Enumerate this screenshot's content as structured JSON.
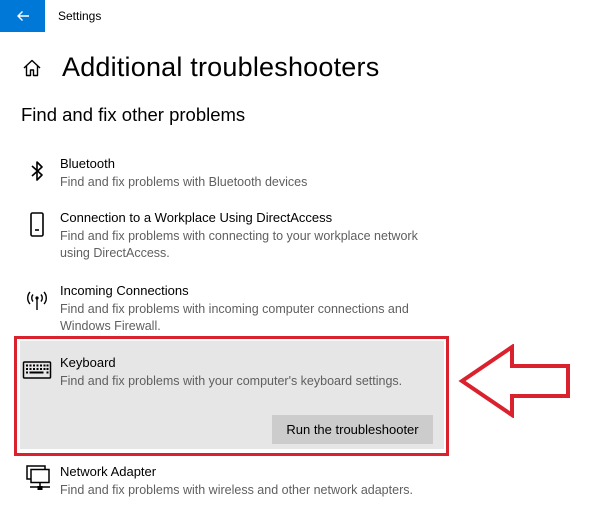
{
  "window": {
    "app_title": "Settings",
    "accent_color": "#0078d7",
    "back_icon": "back-arrow-icon"
  },
  "header": {
    "home_icon": "home-icon",
    "page_title": "Additional troubleshooters",
    "section_title": "Find and fix other problems"
  },
  "items": [
    {
      "icon": "bluetooth-icon",
      "label": "Bluetooth",
      "description": "Find and fix problems with Bluetooth devices"
    },
    {
      "icon": "phone-device-icon",
      "label": "Connection to a Workplace Using DirectAccess",
      "description": "Find and fix problems with connecting to your workplace network using DirectAccess."
    },
    {
      "icon": "wireless-signal-icon",
      "label": "Incoming Connections",
      "description": "Find and fix problems with incoming computer connections and Windows Firewall."
    },
    {
      "icon": "keyboard-icon",
      "label": "Keyboard",
      "description": "Find and fix problems with your computer's keyboard settings.",
      "selected": true,
      "button_label": "Run the troubleshooter"
    },
    {
      "icon": "network-adapter-icon",
      "label": "Network Adapter",
      "description": "Find and fix problems with wireless and other network adapters."
    }
  ],
  "annotation": {
    "highlight_color": "#d9222e",
    "arrow_icon": "left-pointing-arrow-icon"
  }
}
